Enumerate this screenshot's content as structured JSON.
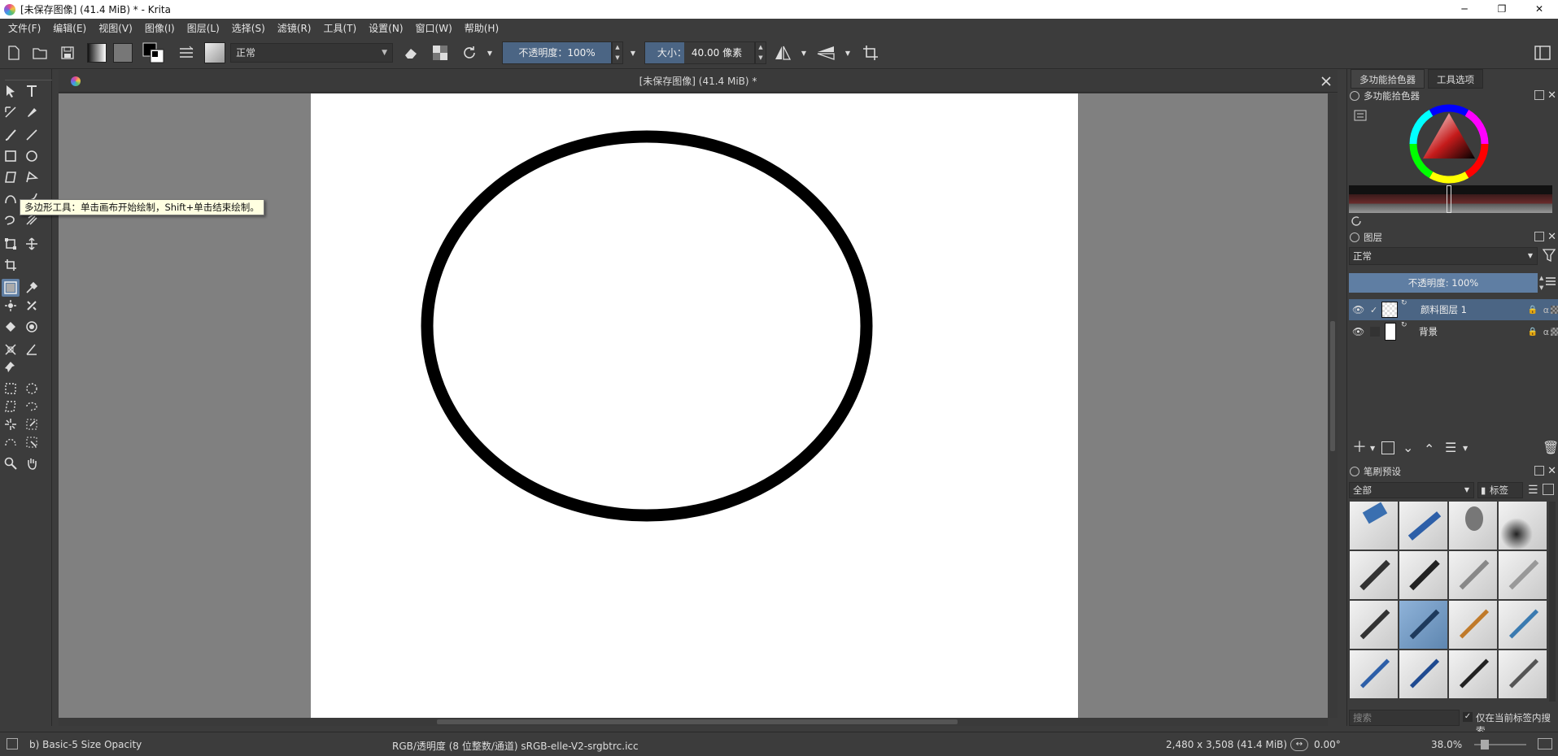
{
  "window": {
    "title": "[未保存图像]  (41.4 MiB) * - Krita",
    "controls": [
      "─",
      "❐",
      "✕"
    ]
  },
  "menu": [
    "文件(F)",
    "编辑(E)",
    "视图(V)",
    "图像(I)",
    "图层(L)",
    "选择(S)",
    "滤镜(R)",
    "工具(T)",
    "设置(N)",
    "窗口(W)",
    "帮助(H)"
  ],
  "toolbar": {
    "blend_mode": "正常",
    "opacity_label": "不透明度：",
    "opacity_value": "100%",
    "size_label": "大小：",
    "size_value": "40.00 像素"
  },
  "tooltip": "多边形工具：单击画布开始绘制，Shift+单击结束绘制。",
  "document": {
    "tab_title": "[未保存图像]  (41.4 MiB) *",
    "close_glyph": "✕"
  },
  "dockers": {
    "tabs": [
      "多功能拾色器",
      "工具选项"
    ],
    "color_selector_title": "多功能拾色器",
    "layers_title": "图层",
    "layers_blend": "正常",
    "layers_opacity": "不透明度:  100%",
    "layers": [
      {
        "name": "颜料图层 1",
        "selected": true
      },
      {
        "name": "背景",
        "selected": false
      }
    ],
    "brush_presets_title": "笔刷预设",
    "brush_filter": "全部",
    "brush_tag": "标签",
    "search_placeholder": "搜索",
    "only_current_tag": "仅在当前标签内搜索"
  },
  "status": {
    "brush": "b) Basic-5 Size Opacity",
    "color_info": "RGB/透明度 (8 位整数/通道)  sRGB-elle-V2-srgbtrc.icc",
    "dimensions": "2,480 x 3,508 (41.4 MiB)",
    "rotation": "0.00°",
    "zoom": "38.0%"
  },
  "colors": {
    "accent": "#4b6584",
    "panel": "#3c3c3c",
    "canvas_bg": "#808080",
    "paper": "#ffffff",
    "stroke": "#000000"
  }
}
